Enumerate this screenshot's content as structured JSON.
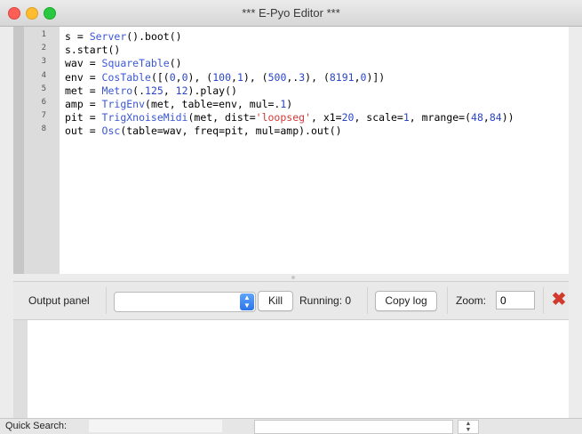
{
  "window": {
    "title": "*** E-Pyo Editor ***"
  },
  "editor": {
    "line_numbers": [
      "1",
      "2",
      "3",
      "4",
      "5",
      "6",
      "7",
      "8"
    ],
    "lines": [
      [
        {
          "t": "s = ",
          "c": "plain"
        },
        {
          "t": "Server",
          "c": "fn"
        },
        {
          "t": "().boot()",
          "c": "plain"
        }
      ],
      [
        {
          "t": "s.start()",
          "c": "plain"
        }
      ],
      [
        {
          "t": "wav = ",
          "c": "plain"
        },
        {
          "t": "SquareTable",
          "c": "fn"
        },
        {
          "t": "()",
          "c": "plain"
        }
      ],
      [
        {
          "t": "env = ",
          "c": "plain"
        },
        {
          "t": "CosTable",
          "c": "fn"
        },
        {
          "t": "([(",
          "c": "plain"
        },
        {
          "t": "0",
          "c": "num"
        },
        {
          "t": ",",
          "c": "plain"
        },
        {
          "t": "0",
          "c": "num"
        },
        {
          "t": "), (",
          "c": "plain"
        },
        {
          "t": "100",
          "c": "num"
        },
        {
          "t": ",",
          "c": "plain"
        },
        {
          "t": "1",
          "c": "num"
        },
        {
          "t": "), (",
          "c": "plain"
        },
        {
          "t": "500",
          "c": "num"
        },
        {
          "t": ",.",
          "c": "plain"
        },
        {
          "t": "3",
          "c": "num"
        },
        {
          "t": "), (",
          "c": "plain"
        },
        {
          "t": "8191",
          "c": "num"
        },
        {
          "t": ",",
          "c": "plain"
        },
        {
          "t": "0",
          "c": "num"
        },
        {
          "t": ")])",
          "c": "plain"
        }
      ],
      [
        {
          "t": "met = ",
          "c": "plain"
        },
        {
          "t": "Metro",
          "c": "fn"
        },
        {
          "t": "(.",
          "c": "plain"
        },
        {
          "t": "125",
          "c": "num"
        },
        {
          "t": ", ",
          "c": "plain"
        },
        {
          "t": "12",
          "c": "num"
        },
        {
          "t": ").play()",
          "c": "plain"
        }
      ],
      [
        {
          "t": "amp = ",
          "c": "plain"
        },
        {
          "t": "TrigEnv",
          "c": "fn"
        },
        {
          "t": "(met, table=env, mul=.",
          "c": "plain"
        },
        {
          "t": "1",
          "c": "num"
        },
        {
          "t": ")",
          "c": "plain"
        }
      ],
      [
        {
          "t": "pit = ",
          "c": "plain"
        },
        {
          "t": "TrigXnoiseMidi",
          "c": "fn"
        },
        {
          "t": "(met, dist=",
          "c": "plain"
        },
        {
          "t": "'loopseg'",
          "c": "str"
        },
        {
          "t": ", x1=",
          "c": "plain"
        },
        {
          "t": "20",
          "c": "num"
        },
        {
          "t": ", scale=",
          "c": "plain"
        },
        {
          "t": "1",
          "c": "num"
        },
        {
          "t": ", mrange=(",
          "c": "plain"
        },
        {
          "t": "48",
          "c": "num"
        },
        {
          "t": ",",
          "c": "plain"
        },
        {
          "t": "84",
          "c": "num"
        },
        {
          "t": "))",
          "c": "plain"
        }
      ],
      [
        {
          "t": "out = ",
          "c": "plain"
        },
        {
          "t": "Osc",
          "c": "fn"
        },
        {
          "t": "(table=wav, freq=pit, mul=amp).out()",
          "c": "plain"
        }
      ]
    ]
  },
  "output_panel": {
    "label": "Output panel",
    "kill_label": "Kill",
    "running_text": "Running: 0",
    "copy_log_label": "Copy log",
    "zoom_label": "Zoom:",
    "zoom_value": "0",
    "close_glyph": "✖"
  },
  "statusbar": {
    "quick_search_label": "Quick Search:"
  },
  "colors": {
    "keyword": "#3a57d4",
    "number": "#2a45c8",
    "string": "#d03a3a",
    "close": "#d13b2d"
  }
}
